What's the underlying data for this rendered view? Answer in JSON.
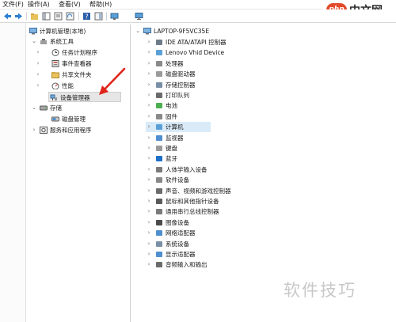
{
  "menu": [
    "文件(F)",
    "操作(A)",
    "查看(V)",
    "帮助(H)"
  ],
  "brand": {
    "logo_text": "php",
    "text": "中文网"
  },
  "watermark": "软件技巧",
  "left_tree": [
    {
      "label": "计算机管理(本地)"
    },
    {
      "label": "系统工具"
    },
    {
      "label": "任务计划程序"
    },
    {
      "label": "事件查看器"
    },
    {
      "label": "共享文件夹"
    },
    {
      "label": "性能"
    },
    {
      "label": "设备管理器"
    },
    {
      "label": "存储"
    },
    {
      "label": "磁盘管理"
    },
    {
      "label": "服务和应用程序"
    }
  ],
  "device_tree": {
    "root": "LAPTOP-9F5VC35E",
    "categories": [
      "IDE ATA/ATAPI 控制器",
      "Lenovo Vhid Device",
      "处理器",
      "磁盘驱动器",
      "存储控制器",
      "打印队列",
      "电池",
      "固件",
      "计算机",
      "监视器",
      "键盘",
      "蓝牙",
      "人体学输入设备",
      "软件设备",
      "声音、视频和游戏控制器",
      "鼠标和其他指针设备",
      "通用串行总线控制器",
      "图像设备",
      "网络适配器",
      "系统设备",
      "显示适配器",
      "音频输入和输出"
    ]
  },
  "colors": {
    "arrow_red": "#e0251b",
    "selection": "#d9ebf9",
    "brand_red": "#e24a2a"
  }
}
